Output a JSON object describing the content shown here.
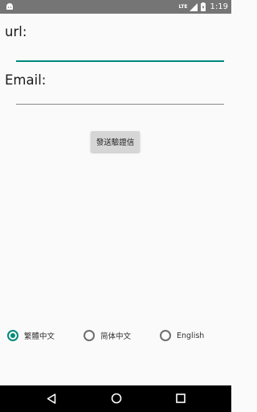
{
  "status_bar": {
    "network": "LTE",
    "time": "1:19"
  },
  "form": {
    "url_label": "url:",
    "url_value": "",
    "email_label": "Email:",
    "email_value": "",
    "send_button_label": "發送驗證信"
  },
  "language": {
    "options": [
      {
        "label": "繁體中文",
        "selected": true
      },
      {
        "label": "简体中文",
        "selected": false
      },
      {
        "label": "English",
        "selected": false
      }
    ]
  },
  "colors": {
    "accent": "#00897b",
    "status_bar": "#757575",
    "nav_bar": "#000000"
  },
  "icons": {
    "status_left": "android-icon",
    "nav": [
      "back-icon",
      "home-icon",
      "recent-apps-icon"
    ]
  }
}
